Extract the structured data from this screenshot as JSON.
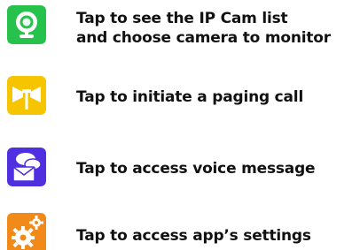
{
  "items": [
    {
      "icon": "ip-camera-icon",
      "color": "#27c24c",
      "lines": [
        "Tap to see the IP Cam list",
        "and choose camera to monitor"
      ]
    },
    {
      "icon": "paging-call-icon",
      "color": "#f7c400",
      "lines": [
        "Tap to initiate a paging call"
      ]
    },
    {
      "icon": "voice-message-icon",
      "color": "#4f2fe0",
      "lines": [
        "Tap to access voice message"
      ]
    },
    {
      "icon": "settings-gears-icon",
      "color": "#f28a1a",
      "lines": [
        "Tap to access app’s settings"
      ]
    }
  ]
}
